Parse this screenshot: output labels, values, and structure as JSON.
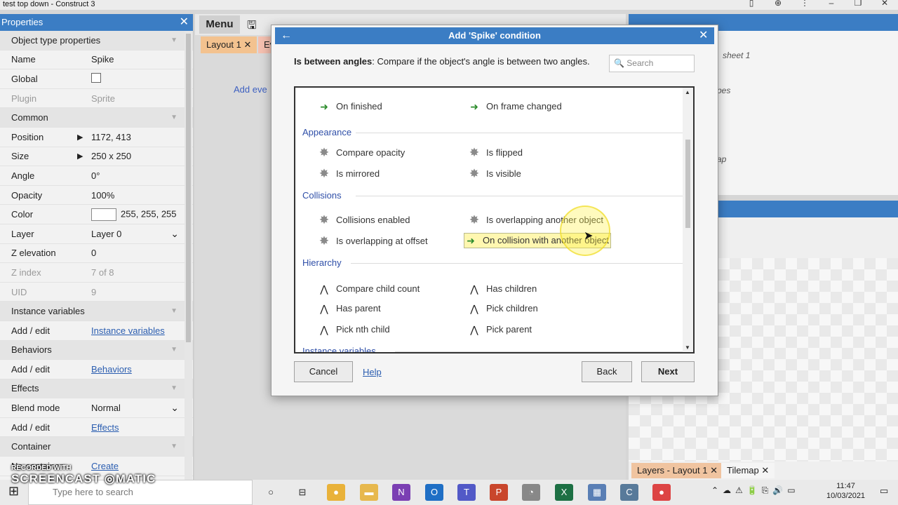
{
  "window": {
    "title": "test top down - Construct 3"
  },
  "properties": {
    "panel_title": "Properties",
    "rows": [
      {
        "type": "section",
        "label": "Object type properties"
      },
      {
        "key": "Name",
        "value": "Spike"
      },
      {
        "key": "Global",
        "value": "",
        "checkbox": false
      },
      {
        "key": "Plugin",
        "value": "Sprite",
        "disabled": true
      },
      {
        "type": "section",
        "label": "Common"
      },
      {
        "key": "Position",
        "value": "1172, 413",
        "expand": true
      },
      {
        "key": "Size",
        "value": "250 x 250",
        "expand": true
      },
      {
        "key": "Angle",
        "value": "0°"
      },
      {
        "key": "Opacity",
        "value": "100%"
      },
      {
        "key": "Color",
        "value": "255, 255, 255",
        "swatch": true
      },
      {
        "key": "Layer",
        "value": "Layer 0",
        "dropdown": true
      },
      {
        "key": "Z elevation",
        "value": "0"
      },
      {
        "key": "Z index",
        "value": "7 of 8",
        "disabled": true
      },
      {
        "key": "UID",
        "value": "9",
        "disabled": true
      },
      {
        "type": "section",
        "label": "Instance variables"
      },
      {
        "key": "Add / edit",
        "value": "Instance variables",
        "link": true
      },
      {
        "type": "section",
        "label": "Behaviors"
      },
      {
        "key": "Add / edit",
        "value": "Behaviors",
        "link": true
      },
      {
        "type": "section",
        "label": "Effects"
      },
      {
        "key": "Blend mode",
        "value": "Normal",
        "dropdown": true
      },
      {
        "key": "Add / edit",
        "value": "Effects",
        "link": true
      },
      {
        "type": "section",
        "label": "Container"
      },
      {
        "key": "No container",
        "value": "Create",
        "link": true
      }
    ]
  },
  "middle": {
    "menu_label": "Menu",
    "tab_layout": "Layout 1",
    "tab_events": "Ev",
    "add_event": "Add eve"
  },
  "right": {
    "texts": [
      "sheet 1",
      "pes",
      "ap"
    ],
    "bottom_tabs": [
      "Layers - Layout 1",
      "Tilemap"
    ]
  },
  "dialog": {
    "title": "Add 'Spike' condition",
    "desc_bold": "Is between angles",
    "desc_text": ": Compare if the object's angle is between two angles.",
    "search_placeholder": "Search",
    "categories": [
      {
        "label": "",
        "items": [
          [
            "On finished",
            "arrow"
          ],
          [
            "On frame changed",
            "arrow"
          ]
        ]
      },
      {
        "label": "Appearance",
        "items": [
          [
            "Compare opacity",
            "spike"
          ],
          [
            "Is flipped",
            "spike"
          ],
          [
            "Is mirrored",
            "spike"
          ],
          [
            "Is visible",
            "spike"
          ]
        ]
      },
      {
        "label": "Collisions",
        "items": [
          [
            "Collisions enabled",
            "spike"
          ],
          [
            "Is overlapping another object",
            "spike"
          ],
          [
            "Is overlapping at offset",
            "spike"
          ],
          [
            "On collision with another object",
            "arrow"
          ]
        ]
      },
      {
        "label": "Hierarchy",
        "items": [
          [
            "Compare child count",
            "tree"
          ],
          [
            "Has children",
            "tree"
          ],
          [
            "Has parent",
            "tree"
          ],
          [
            "Pick children",
            "tree"
          ],
          [
            "Pick nth child",
            "tree"
          ],
          [
            "Pick parent",
            "tree"
          ]
        ]
      },
      {
        "label": "Instance variables",
        "items": []
      }
    ],
    "selected_item": "On collision with another object",
    "buttons": {
      "cancel": "Cancel",
      "help": "Help",
      "back": "Back",
      "next": "Next"
    }
  },
  "taskbar": {
    "search_placeholder": "Type here to search",
    "time": "11:47",
    "date": "10/03/2021"
  },
  "watermark": {
    "line1": "RECORDED WITH",
    "line2": "SCREENCAST",
    "line3": "MATIC"
  }
}
